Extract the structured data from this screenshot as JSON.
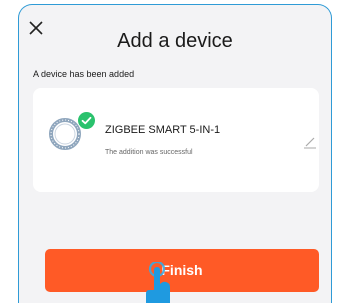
{
  "dialog": {
    "title": "Add a device",
    "status_text": "A device has been added"
  },
  "device": {
    "name": "ZIGBEE SMART 5-IN-1",
    "status": "The addition was successful"
  },
  "actions": {
    "finish_label": "Finish"
  },
  "colors": {
    "border": "#2f9bd6",
    "finish_button": "#ff5a26",
    "check_badge": "#2ac26d",
    "background": "#f3f3f5"
  },
  "icons": {
    "close": "close-icon",
    "device": "ring-sensor-icon",
    "badge": "check-icon",
    "edit": "pencil-icon",
    "pointer": "hand-pointer-icon"
  }
}
